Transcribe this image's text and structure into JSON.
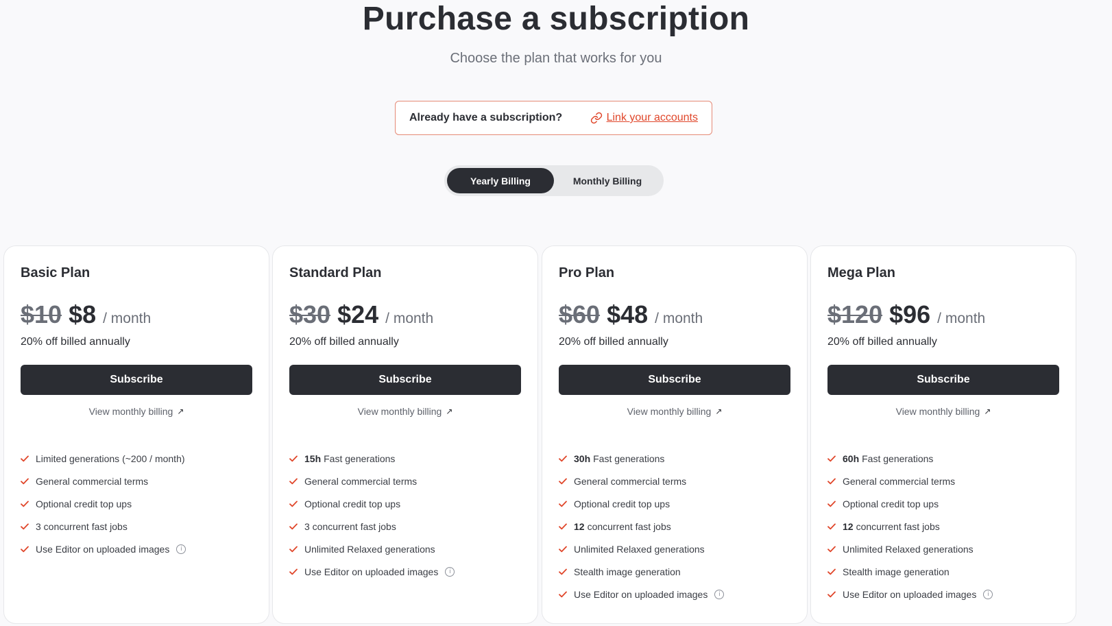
{
  "header": {
    "title": "Purchase a subscription",
    "subtitle": "Choose the plan that works for you"
  },
  "link_box": {
    "question": "Already have a subscription?",
    "link_label": "Link your accounts"
  },
  "billing_toggle": {
    "options": [
      "Yearly Billing",
      "Monthly Billing"
    ],
    "selected": "Yearly Billing"
  },
  "plans": [
    {
      "name": "Basic Plan",
      "old_price": "$10",
      "price": "$8",
      "period": "/ month",
      "discount": "20% off billed annually",
      "subscribe_label": "Subscribe",
      "monthly_label": "View monthly billing",
      "features": [
        {
          "bold": "",
          "text": "Limited generations (~200 / month)",
          "info": false
        },
        {
          "bold": "",
          "text": "General commercial terms",
          "info": false
        },
        {
          "bold": "",
          "text": "Optional credit top ups",
          "info": false
        },
        {
          "bold": "",
          "text": "3 concurrent fast jobs",
          "info": false
        },
        {
          "bold": "",
          "text": "Use Editor on uploaded images",
          "info": true
        }
      ]
    },
    {
      "name": "Standard Plan",
      "old_price": "$30",
      "price": "$24",
      "period": "/ month",
      "discount": "20% off billed annually",
      "subscribe_label": "Subscribe",
      "monthly_label": "View monthly billing",
      "features": [
        {
          "bold": "15h",
          "text": "Fast generations",
          "info": false
        },
        {
          "bold": "",
          "text": "General commercial terms",
          "info": false
        },
        {
          "bold": "",
          "text": "Optional credit top ups",
          "info": false
        },
        {
          "bold": "",
          "text": "3 concurrent fast jobs",
          "info": false
        },
        {
          "bold": "",
          "text": "Unlimited Relaxed generations",
          "info": false
        },
        {
          "bold": "",
          "text": "Use Editor on uploaded images",
          "info": true
        }
      ]
    },
    {
      "name": "Pro Plan",
      "old_price": "$60",
      "price": "$48",
      "period": "/ month",
      "discount": "20% off billed annually",
      "subscribe_label": "Subscribe",
      "monthly_label": "View monthly billing",
      "features": [
        {
          "bold": "30h",
          "text": "Fast generations",
          "info": false
        },
        {
          "bold": "",
          "text": "General commercial terms",
          "info": false
        },
        {
          "bold": "",
          "text": "Optional credit top ups",
          "info": false
        },
        {
          "bold": "12",
          "text": "concurrent fast jobs",
          "info": false
        },
        {
          "bold": "",
          "text": "Unlimited Relaxed generations",
          "info": false
        },
        {
          "bold": "",
          "text": "Stealth image generation",
          "info": false
        },
        {
          "bold": "",
          "text": "Use Editor on uploaded images",
          "info": true
        }
      ]
    },
    {
      "name": "Mega Plan",
      "old_price": "$120",
      "price": "$96",
      "period": "/ month",
      "discount": "20% off billed annually",
      "subscribe_label": "Subscribe",
      "monthly_label": "View monthly billing",
      "features": [
        {
          "bold": "60h",
          "text": "Fast generations",
          "info": false
        },
        {
          "bold": "",
          "text": "General commercial terms",
          "info": false
        },
        {
          "bold": "",
          "text": "Optional credit top ups",
          "info": false
        },
        {
          "bold": "12",
          "text": "concurrent fast jobs",
          "info": false
        },
        {
          "bold": "",
          "text": "Unlimited Relaxed generations",
          "info": false
        },
        {
          "bold": "",
          "text": "Stealth image generation",
          "info": false
        },
        {
          "bold": "",
          "text": "Use Editor on uploaded images",
          "info": true
        }
      ]
    }
  ],
  "icons": {
    "link": "link-icon",
    "check": "check-icon",
    "external": "arrow-up-right-icon",
    "info": "info-icon"
  },
  "colors": {
    "accent": "#e0462a",
    "dark": "#2b2d33",
    "check": "#e0462a"
  }
}
